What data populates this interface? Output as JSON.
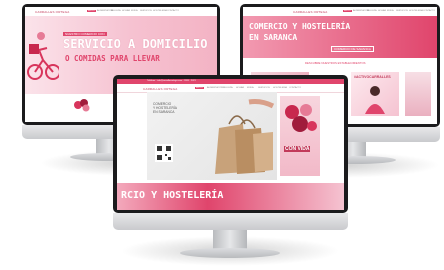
{
  "left_screen": {
    "logo": "CARRALLES ORTEGA",
    "nav": [
      "INICIO",
      "ALIMENTACIÓN",
      "BELLEZA",
      "HOGAR",
      "MODA",
      "SERVICIOS",
      "HOSTELERÍA",
      "CONTACTO"
    ],
    "kicker": "NUESTRO COMERCIO CON",
    "headline": "SERVICIO A DOMICILIO",
    "subline": "O COMIDAS PARA LLEVAR"
  },
  "right_screen": {
    "logo": "CARRALLES ORTEGA",
    "nav": [
      "INICIO",
      "ALIMENTACIÓN",
      "BELLEZA",
      "HOGAR",
      "MODA",
      "SERVICIOS",
      "HOSTELERÍA",
      "CONTACTO"
    ],
    "headline_1": "COMERCIO Y HOSTELERÍA",
    "headline_2": "EN SARANCA",
    "tag": "COMERCIO DE SARANCA",
    "section_label": "DESCUBRE NUESTROS ESTABLECIMIENTOS",
    "badge": "#ACTIVOCARRALLES"
  },
  "center_screen": {
    "topbar": "Teléfono · info@carrallesortega.com · 2020 · 2021",
    "logo": "CARRALLES ORTEGA",
    "nav": [
      "INICIO",
      "ALIMENTACIÓN",
      "BELLEZA",
      "HOGAR",
      "MODA",
      "SERVICIOS",
      "HOSTELERÍA",
      "CONTACTO"
    ],
    "promo_lines": [
      "COMERCIO",
      "Y HOSTELERÍA",
      "EN SARANCA"
    ],
    "art_text": "CON VIDA",
    "footer_banner": "RCIO Y HOSTELERÍA"
  },
  "colors": {
    "brand": "#e0456c",
    "brand_light": "#f7c7d3",
    "bezel": "#1b1b1d"
  }
}
